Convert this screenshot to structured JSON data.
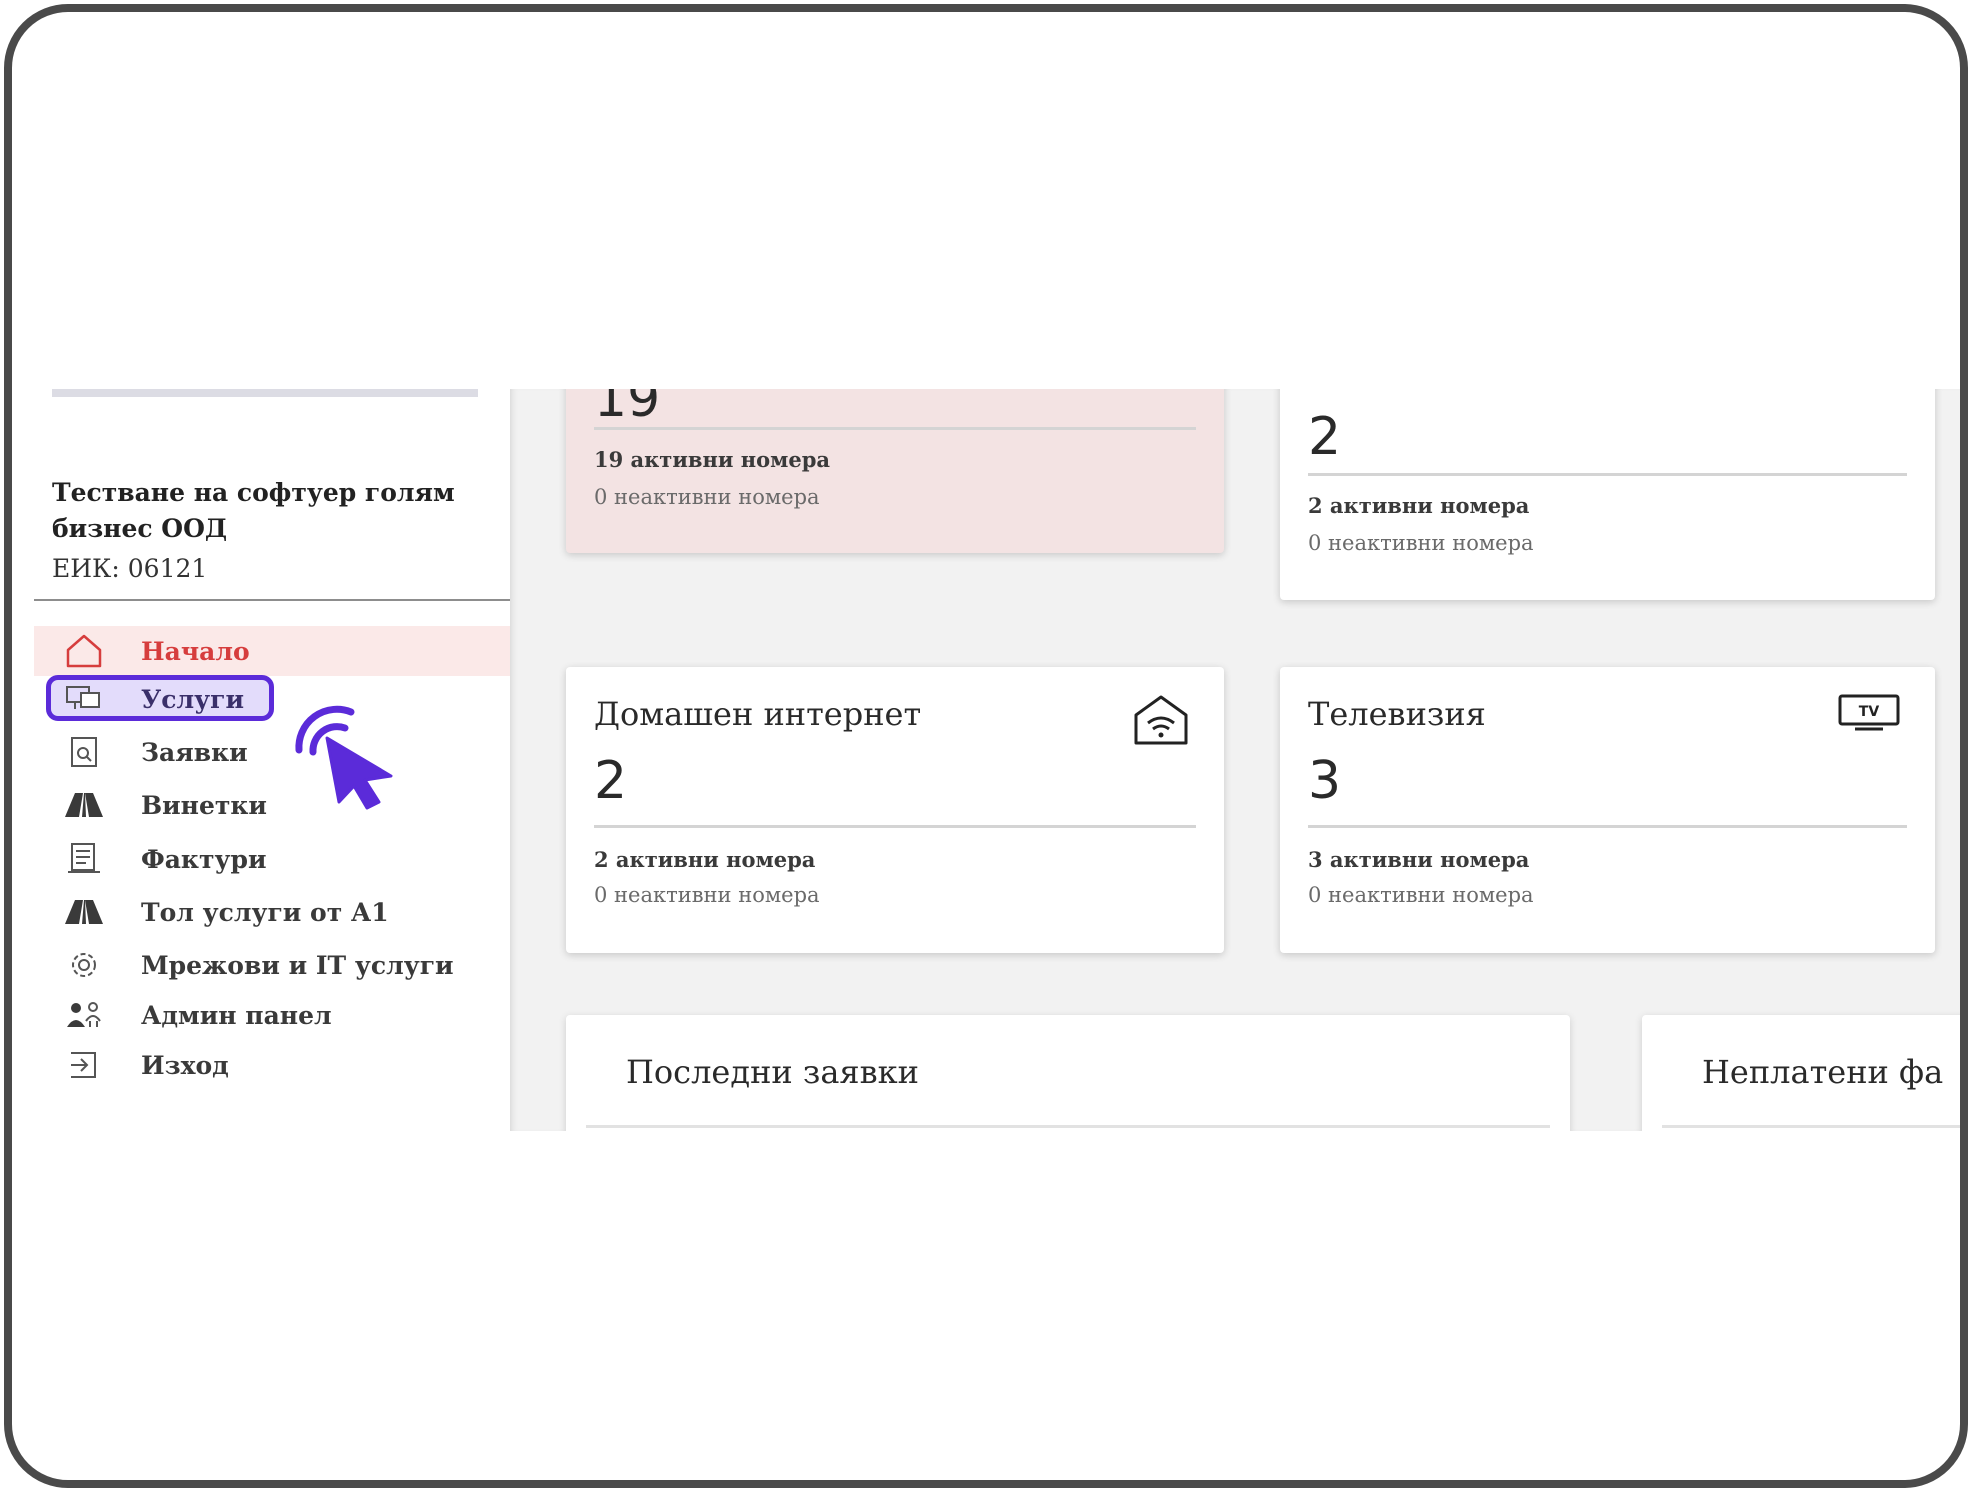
{
  "sidebar": {
    "company_name": "Тестване на софтуер голям бизнес ООД",
    "eik": "ЕИК: 06121",
    "items": [
      {
        "label": "Начало",
        "icon": "home-icon",
        "state": "active"
      },
      {
        "label": "Услуги",
        "icon": "services-icon",
        "state": "highlighted"
      },
      {
        "label": "Заявки",
        "icon": "requests-icon"
      },
      {
        "label": "Винетки",
        "icon": "vignette-road-icon"
      },
      {
        "label": "Фактури",
        "icon": "invoice-icon"
      },
      {
        "label": "Тол услуги от А1",
        "icon": "toll-road-icon"
      },
      {
        "label": "Мрежови и IT услуги",
        "icon": "gear-icon"
      },
      {
        "label": "Админ панел",
        "icon": "admin-users-icon"
      },
      {
        "label": "Изход",
        "icon": "logout-icon"
      }
    ]
  },
  "cards": [
    {
      "value": "19",
      "active": "19 активни номера",
      "inactive": "0 неактивни номера"
    },
    {
      "value": "2",
      "active": "2 активни номера",
      "inactive": "0 неактивни номера"
    },
    {
      "title": "Домашен интернет",
      "icon": "home-wifi-icon",
      "value": "2",
      "active": "2 активни номера",
      "inactive": "0 неактивни номера"
    },
    {
      "title": "Телевизия",
      "icon": "tv-icon",
      "value": "3",
      "active": "3 активни номера",
      "inactive": "0 неактивни номера"
    }
  ],
  "panels": {
    "recent_requests": "Последни заявки",
    "unpaid_invoices": "Неплатени фа"
  },
  "colors": {
    "active_nav": "#d63d3d",
    "highlight": "#5b2bd9",
    "pink_card": "#f3e3e3"
  }
}
